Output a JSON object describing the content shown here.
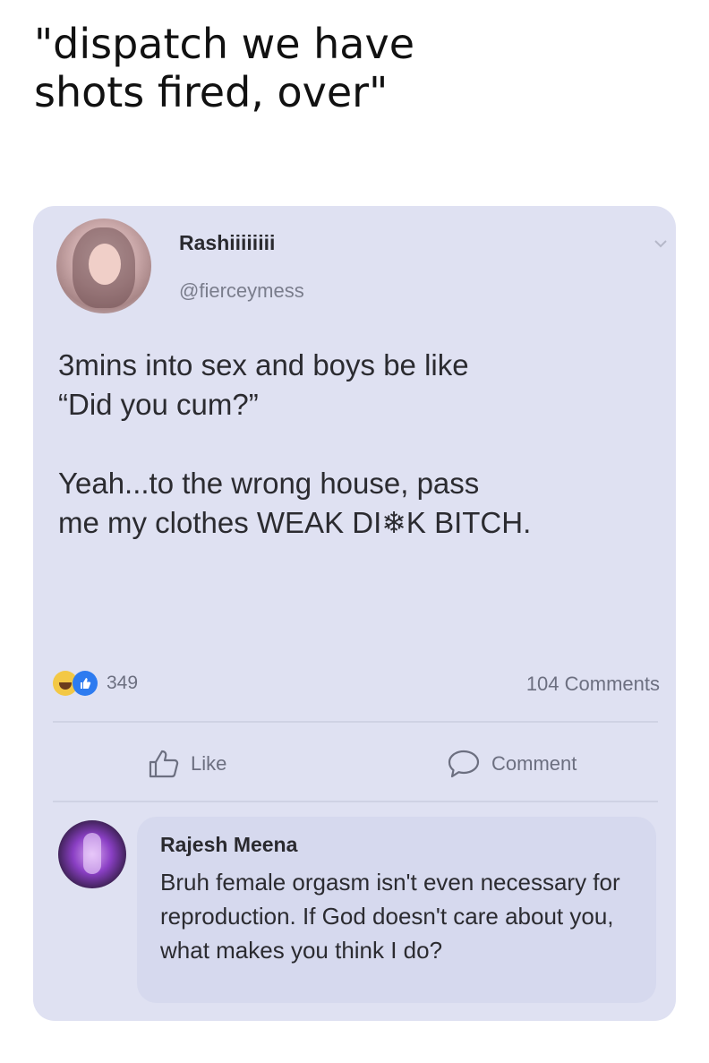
{
  "caption": "\"dispatch we have\nshots fired, over\"",
  "post": {
    "author_name": "Rashiiiiiiii",
    "author_handle": "@fierceymess",
    "text": "3mins into sex and boys be like\n“Did you cum?”\n\nYeah...to the wrong house, pass\nme my clothes WEAK DI❄K BITCH.",
    "reaction_count": "349",
    "comments_count": "104 Comments"
  },
  "actions": {
    "like_label": "Like",
    "comment_label": "Comment"
  },
  "comment": {
    "author": "Rajesh Meena",
    "text": "Bruh female orgasm isn't even necessary for reproduction. If God doesn't care about you, what makes you think I do?"
  },
  "icons": {
    "chevron": "chevron-down-icon",
    "haha": "haha-reaction-icon",
    "like_reaction": "like-reaction-icon",
    "like_action": "thumbs-up-icon",
    "comment_action": "speech-bubble-icon"
  },
  "colors": {
    "card_background": "#dfe1f2",
    "comment_bubble": "#d6d9ee",
    "like_blue": "#2d7bf0",
    "haha_yellow": "#f3c845",
    "secondary_text": "#6c6f80"
  }
}
